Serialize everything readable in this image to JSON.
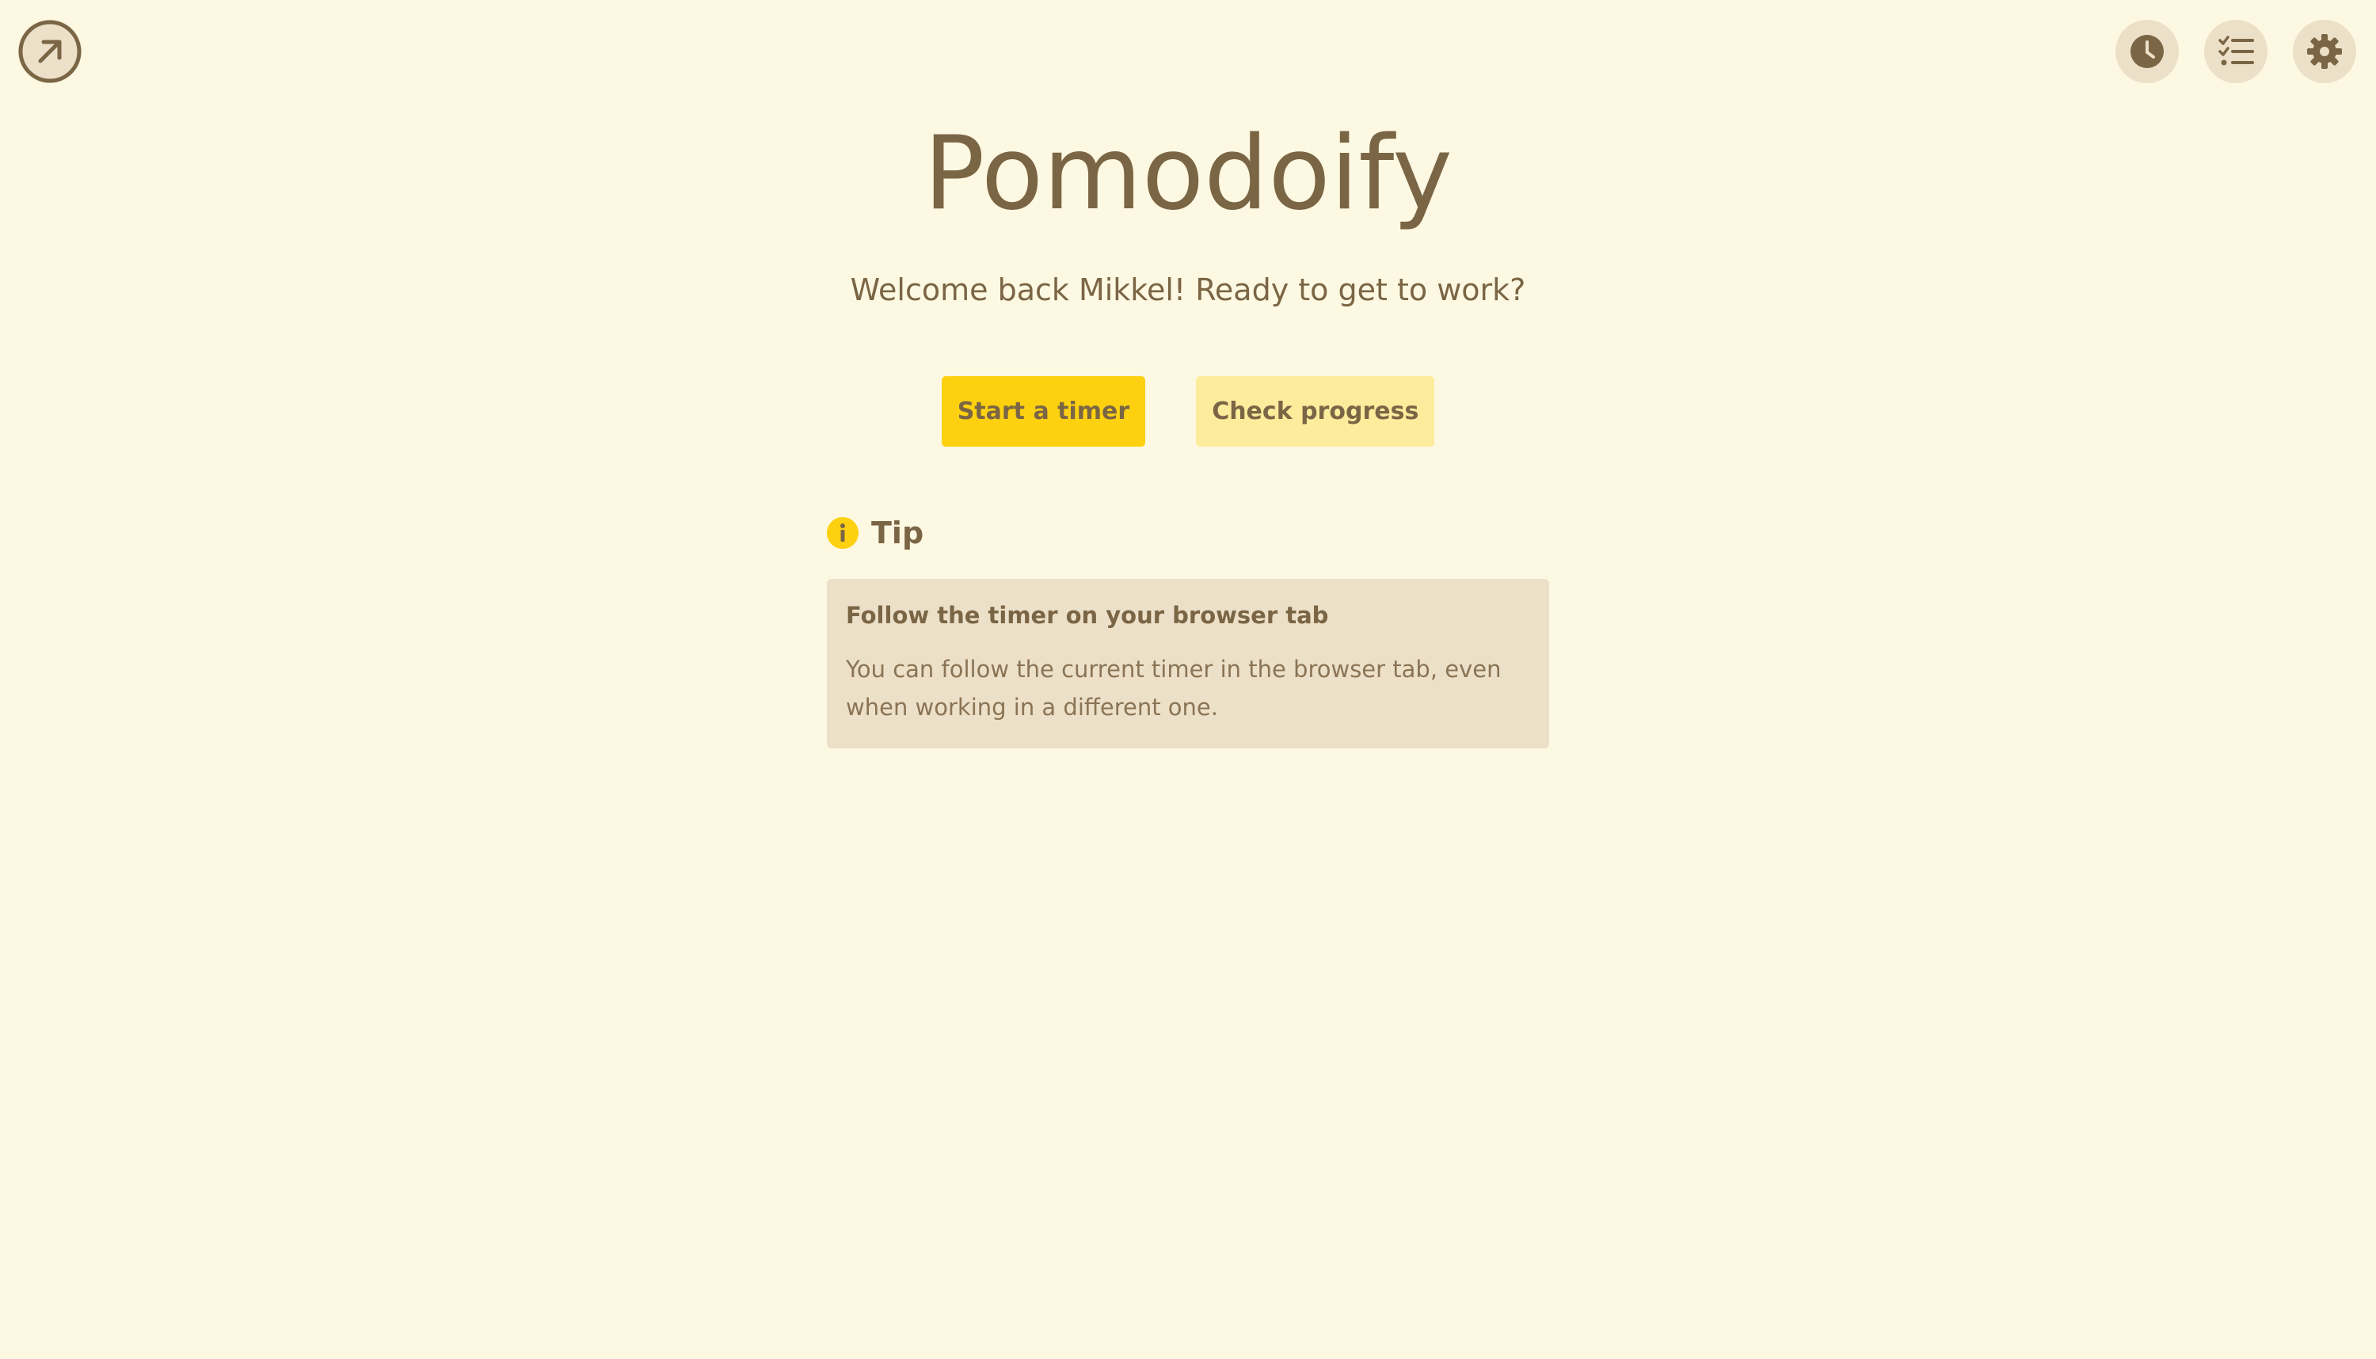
{
  "app": {
    "logo_icon": "arrow-up-right-circle-icon",
    "title": "Pomodoify",
    "welcome": "Welcome back Mikkel! Ready to get to work?"
  },
  "top_nav": {
    "icons": [
      "clock-icon",
      "checklist-icon",
      "gear-icon"
    ]
  },
  "actions": {
    "start_label": "Start a timer",
    "progress_label": "Check progress"
  },
  "tip": {
    "icon": "info-icon",
    "heading": "Tip",
    "title": "Follow the timer on your browser tab",
    "body": "You can follow the current timer in the browser tab, even when working in a different one."
  },
  "colors": {
    "background": "#fdf8e1",
    "text": "#7a6545",
    "primary_button": "#fdd110",
    "secondary_button": "#fcec9c",
    "card": "#ede0c8",
    "icon_bg": "#ede0c8"
  }
}
